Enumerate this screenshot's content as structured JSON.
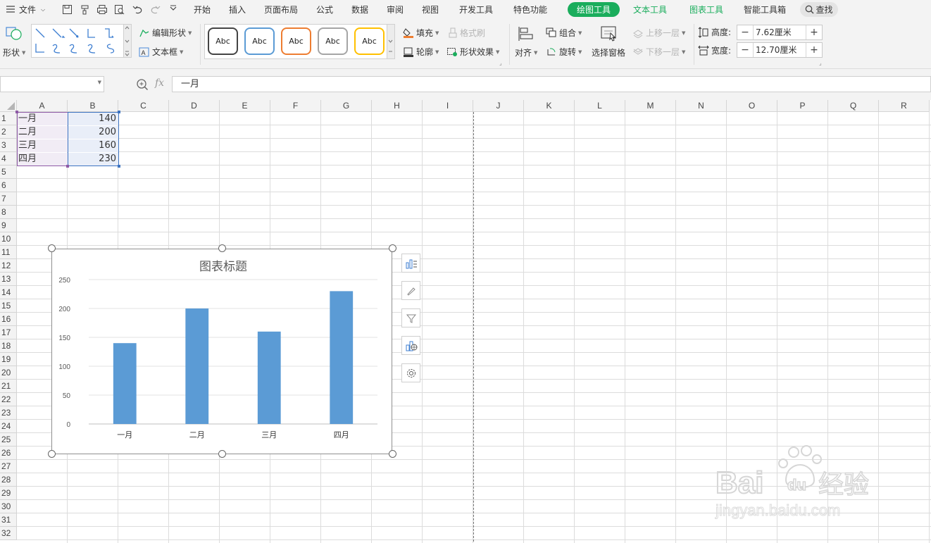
{
  "menubar": {
    "file_label": "文件",
    "tabs": [
      "开始",
      "插入",
      "页面布局",
      "公式",
      "数据",
      "审阅",
      "视图",
      "开发工具",
      "特色功能"
    ],
    "tool_tabs": {
      "draw": "绘图工具",
      "text": "文本工具",
      "chart": "图表工具",
      "smart": "智能工具箱"
    },
    "search_label": "查找"
  },
  "ribbon": {
    "shape_label": "形状",
    "edit_shape_label": "编辑形状",
    "textbox_label": "文本框",
    "style_samples": [
      "Abc",
      "Abc",
      "Abc",
      "Abc",
      "Abc"
    ],
    "style_colors": [
      "#444444",
      "#5b9bd5",
      "#ed7d31",
      "#a5a5a5",
      "#ffc000"
    ],
    "fill_label": "填充",
    "outline_label": "轮廓",
    "format_brush_label": "格式刷",
    "shape_effect_label": "形状效果",
    "align_label": "对齐",
    "group_label": "组合",
    "rotate_label": "旋转",
    "select_pane_label": "选择窗格",
    "bring_forward_label": "上移一层",
    "send_backward_label": "下移一层",
    "height_label": "高度:",
    "height_value": "7.62厘米",
    "width_label": "宽度:",
    "width_value": "12.70厘米"
  },
  "formula_bar": {
    "name_box": "",
    "fx_label": "fx",
    "content": "一月"
  },
  "sheet": {
    "columns": [
      "A",
      "B",
      "C",
      "D",
      "E",
      "F",
      "G",
      "H",
      "I",
      "J",
      "K",
      "L",
      "M",
      "N",
      "O",
      "P",
      "Q",
      "R"
    ],
    "rows": [
      "1",
      "2",
      "3",
      "4",
      "5",
      "6",
      "7",
      "8",
      "9",
      "10",
      "11",
      "12",
      "13",
      "14",
      "15",
      "16",
      "17",
      "18",
      "19",
      "20",
      "21",
      "22",
      "23",
      "24",
      "25",
      "26",
      "27",
      "28",
      "29",
      "30",
      "31",
      "32"
    ],
    "data": [
      {
        "month": "一月",
        "value": "140"
      },
      {
        "month": "二月",
        "value": "200"
      },
      {
        "month": "三月",
        "value": "160"
      },
      {
        "month": "四月",
        "value": "230"
      }
    ]
  },
  "chart_data": {
    "type": "bar",
    "title": "图表标题",
    "categories": [
      "一月",
      "二月",
      "三月",
      "四月"
    ],
    "values": [
      140,
      200,
      160,
      230
    ],
    "ylim": [
      0,
      250
    ],
    "yticks": [
      0,
      50,
      100,
      150,
      200,
      250
    ],
    "xlabel": "",
    "ylabel": "",
    "grid": true,
    "bar_color": "#5b9bd5"
  },
  "colors": {
    "accent_green": "#1aad5c",
    "selection_purple": "#8e5aa6",
    "selection_blue": "#3e74c2"
  },
  "watermark": {
    "brand": "Bai du 经验",
    "url": "jingyan.baidu.com"
  }
}
